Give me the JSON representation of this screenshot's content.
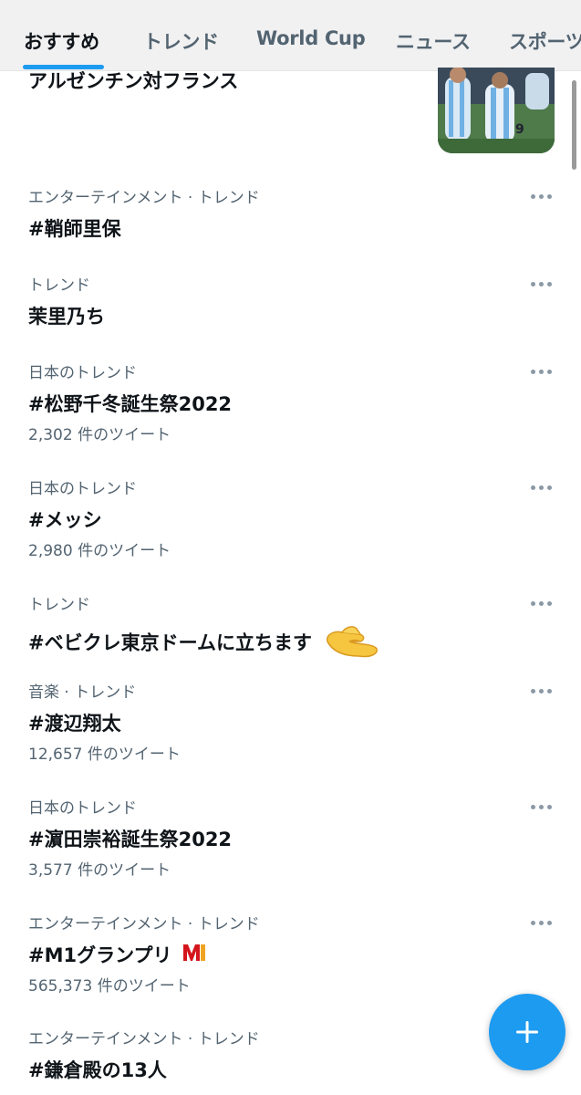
{
  "tabs": [
    {
      "label": "おすすめ",
      "active": true
    },
    {
      "label": "トレンド",
      "active": false
    },
    {
      "label": "World Cup",
      "active": false
    },
    {
      "label": "ニュース",
      "active": false
    },
    {
      "label": "スポーツ",
      "active": false
    }
  ],
  "topic": {
    "title": "アルゼンチン対フランス"
  },
  "trends": [
    {
      "meta": "エンターテインメント · トレンド",
      "title": "#鞘師里保"
    },
    {
      "meta": "トレンド",
      "title": "茉里乃ち"
    },
    {
      "meta": "日本のトレンド",
      "title": "#松野千冬誕生祭2022",
      "count": "2,302 件のツイート"
    },
    {
      "meta": "日本のトレンド",
      "title": "#メッシ",
      "count": "2,980 件のツイート"
    },
    {
      "meta": "トレンド",
      "title": "#ベビクレ東京ドームに立ちます"
    },
    {
      "meta": "音楽 · トレンド",
      "title": "#渡辺翔太",
      "count": "12,657 件のツイート"
    },
    {
      "meta": "日本のトレンド",
      "title": "#濵田崇裕誕生祭2022",
      "count": "3,577 件のツイート"
    },
    {
      "meta": "エンターテインメント · トレンド",
      "title": "#M1グランプリ",
      "count": "565,373 件のツイート"
    },
    {
      "meta": "エンターテインメント · トレンド",
      "title": "#鎌倉殿の13人"
    }
  ],
  "icons": {
    "more": "more-dots-icon",
    "pinch_hand": "pinching-hand-emoji",
    "m1_logo": "m1-logo-icon",
    "compose": "plus-icon"
  },
  "colors": {
    "accent": "#1d9bf0",
    "text_primary": "#0f1419",
    "text_secondary": "#536471",
    "tabbar_bg": "#f1f1f2"
  }
}
